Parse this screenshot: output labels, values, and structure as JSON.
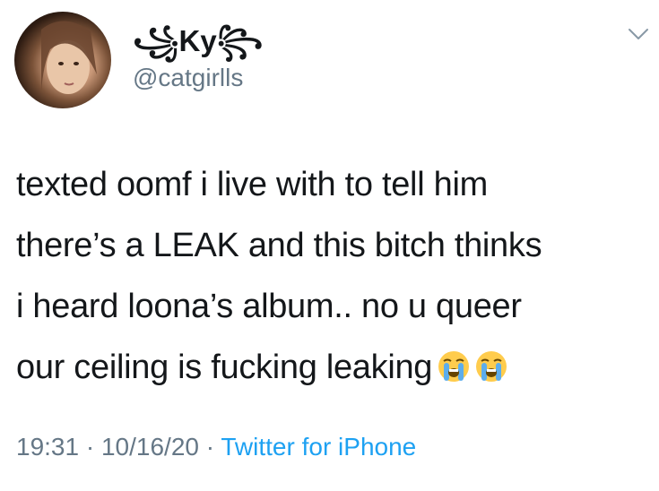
{
  "tweet": {
    "author": {
      "display_name": "꧁Ky꧂",
      "handle": "@catgirlls"
    },
    "text_lines": [
      "texted oomf i live with to tell him",
      "there’s a LEAK and this bitch thinks",
      "i heard loona’s album.. no u queer",
      "our ceiling is fucking leaking"
    ],
    "emoji": [
      "loudly-crying-face",
      "loudly-crying-face"
    ],
    "time": "19:31",
    "separator": " · ",
    "date": "10/16/20",
    "source": "Twitter for iPhone"
  },
  "colors": {
    "text": "#14171a",
    "secondary": "#657786",
    "link": "#1da1f2"
  }
}
